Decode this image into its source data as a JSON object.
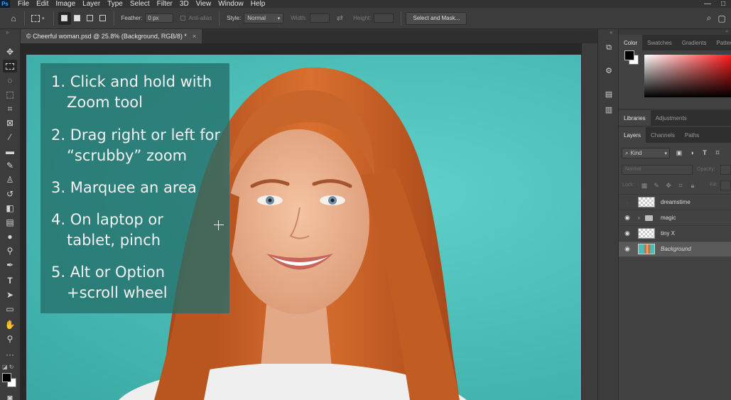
{
  "app": {
    "logo": "Ps"
  },
  "menu": [
    "File",
    "Edit",
    "Image",
    "Layer",
    "Type",
    "Select",
    "Filter",
    "3D",
    "View",
    "Window",
    "Help"
  ],
  "window_controls": [
    "—",
    "□"
  ],
  "options_bar": {
    "feather_label": "Feather:",
    "feather_value": "0 px",
    "antialias_label": "Anti-alias",
    "style_label": "Style:",
    "style_value": "Normal",
    "width_label": "Width:",
    "height_label": "Height:",
    "select_mask_label": "Select and Mask..."
  },
  "document": {
    "tab_title": "© Cheerful woman.psd @ 25.8% (Background, RGB/8) *",
    "close": "×"
  },
  "canvas_overlay": {
    "steps": [
      {
        "line1": "1. Click and hold with",
        "line2": "Zoom tool"
      },
      {
        "line1": "2. Drag right or left for",
        "line2": "“scrubby” zoom"
      },
      {
        "line1": "3. Marquee an area",
        "line2": ""
      },
      {
        "line1": "4. On laptop or",
        "line2": "tablet, pinch"
      },
      {
        "line1": "5. Alt or Option",
        "line2": "+scroll wheel"
      }
    ]
  },
  "color_panel": {
    "tabs": [
      "Color",
      "Swatches",
      "Gradients",
      "Patter"
    ],
    "active_tab": "Color",
    "foreground": "#000000",
    "background": "#ffffff"
  },
  "libraries_panel": {
    "tabs": [
      "Libraries",
      "Adjustments"
    ]
  },
  "layers_panel": {
    "tabs": [
      "Layers",
      "Channels",
      "Paths"
    ],
    "kind_label": "Kind",
    "blend_mode": "Normal",
    "opacity_label": "Opacity:",
    "lock_label": "Lock:",
    "fill_label": "Fill:",
    "layers": [
      {
        "name": "dreamstime",
        "visible": false,
        "type": "smart"
      },
      {
        "name": "magic",
        "visible": true,
        "type": "group"
      },
      {
        "name": "tiny X",
        "visible": true,
        "type": "pixel"
      },
      {
        "name": "Background",
        "visible": true,
        "type": "photo",
        "selected": true
      }
    ]
  }
}
